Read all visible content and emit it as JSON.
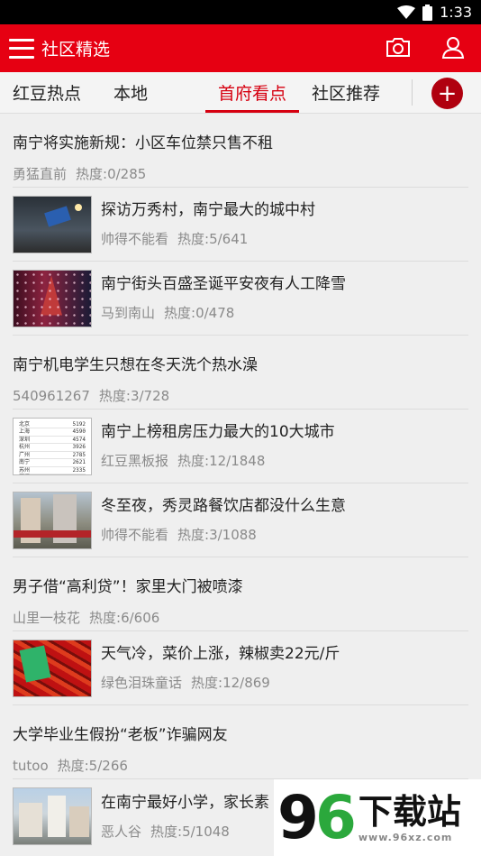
{
  "status_bar": {
    "time": "1:33"
  },
  "app_bar": {
    "title": "社区精选",
    "icons": [
      "menu-icon",
      "camera-icon",
      "user-icon"
    ]
  },
  "tabs": [
    {
      "label": "红豆热点"
    },
    {
      "label": "本地"
    },
    {
      "label": "首府看点",
      "active": true
    },
    {
      "label": "社区推荐"
    }
  ],
  "add_button": {
    "label": "+"
  },
  "posts": [
    {
      "title": "南宁将实施新规：小区车位禁只售不租",
      "author": "勇猛直前",
      "heat": "热度:0/285"
    },
    {
      "title": "探访万秀村，南宁最大的城中村",
      "author": "帅得不能看",
      "heat": "热度:5/641"
    },
    {
      "title": "南宁街头百盛圣诞平安夜有人工降雪",
      "author": "马到南山",
      "heat": "热度:0/478"
    },
    {
      "title": "南宁机电学生只想在冬天洗个热水澡",
      "author": "540961267",
      "heat": "热度:3/728"
    },
    {
      "title": "南宁上榜租房压力最大的10大城市",
      "author": "红豆黑板报",
      "heat": "热度:12/1848"
    },
    {
      "title": "冬至夜，秀灵路餐饮店都没什么生意",
      "author": "帅得不能看",
      "heat": "热度:3/1088"
    },
    {
      "title": "男子借“高利贷”！家里大门被喷漆",
      "author": "山里一枝花",
      "heat": "热度:6/606"
    },
    {
      "title": "天气冷，菜价上涨，辣椒卖22元/斤",
      "author": "绿色泪珠童话",
      "heat": "热度:12/869"
    },
    {
      "title": "大学毕业生假扮“老板”诈骗网友",
      "author": "tutoo",
      "heat": "热度:5/266"
    },
    {
      "title": "在南宁最好小学，家长素",
      "author": "恶人谷",
      "heat": "热度:5/1048"
    }
  ],
  "rent_table": [
    [
      "北京",
      "5192"
    ],
    [
      "上海",
      "4590"
    ],
    [
      "深圳",
      "4574"
    ],
    [
      "杭州",
      "3926"
    ],
    [
      "广州",
      "2785"
    ],
    [
      "南宁",
      "2621"
    ],
    [
      "苏州",
      "2335"
    ],
    [
      "厦门",
      "2236"
    ]
  ],
  "watermark": {
    "num_a": "9",
    "num_b": "6",
    "text": "下载站",
    "url": "www.96xz.com"
  }
}
